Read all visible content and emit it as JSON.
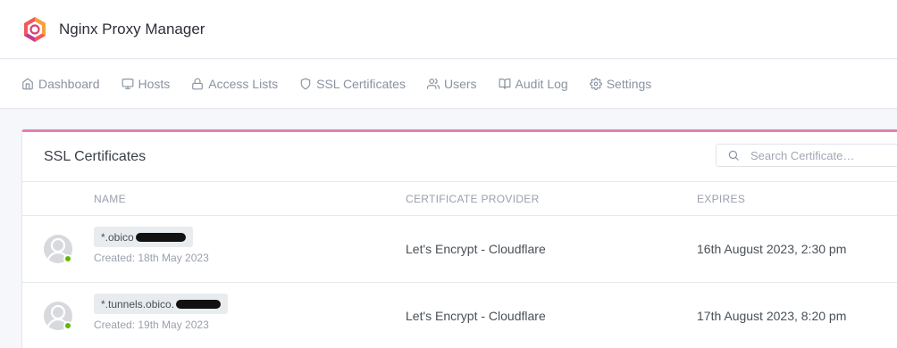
{
  "app": {
    "title": "Nginx Proxy Manager"
  },
  "nav": {
    "items": [
      {
        "label": "Dashboard",
        "icon": "home-icon"
      },
      {
        "label": "Hosts",
        "icon": "monitor-icon"
      },
      {
        "label": "Access Lists",
        "icon": "lock-icon"
      },
      {
        "label": "SSL Certificates",
        "icon": "shield-icon"
      },
      {
        "label": "Users",
        "icon": "users-icon"
      },
      {
        "label": "Audit Log",
        "icon": "book-icon"
      },
      {
        "label": "Settings",
        "icon": "gear-icon"
      }
    ]
  },
  "card": {
    "title": "SSL Certificates",
    "search": {
      "placeholder": "Search Certificate…",
      "value": ""
    },
    "columns": [
      "NAME",
      "CERTIFICATE PROVIDER",
      "EXPIRES"
    ],
    "rows": [
      {
        "name": "*.obico",
        "created": "Created: 18th May 2023",
        "provider": "Let's Encrypt - Cloudflare",
        "expires": "16th August 2023, 2:30 pm",
        "status": "active"
      },
      {
        "name": "*.tunnels.obico.",
        "created": "Created: 19th May 2023",
        "provider": "Let's Encrypt - Cloudflare",
        "expires": "17th August 2023, 8:20 pm",
        "status": "active"
      }
    ]
  },
  "colors": {
    "accent": "#e57fb0",
    "status_online": "#5eba00",
    "nav_text": "#8a93a1",
    "background": "#f5f7fb"
  }
}
